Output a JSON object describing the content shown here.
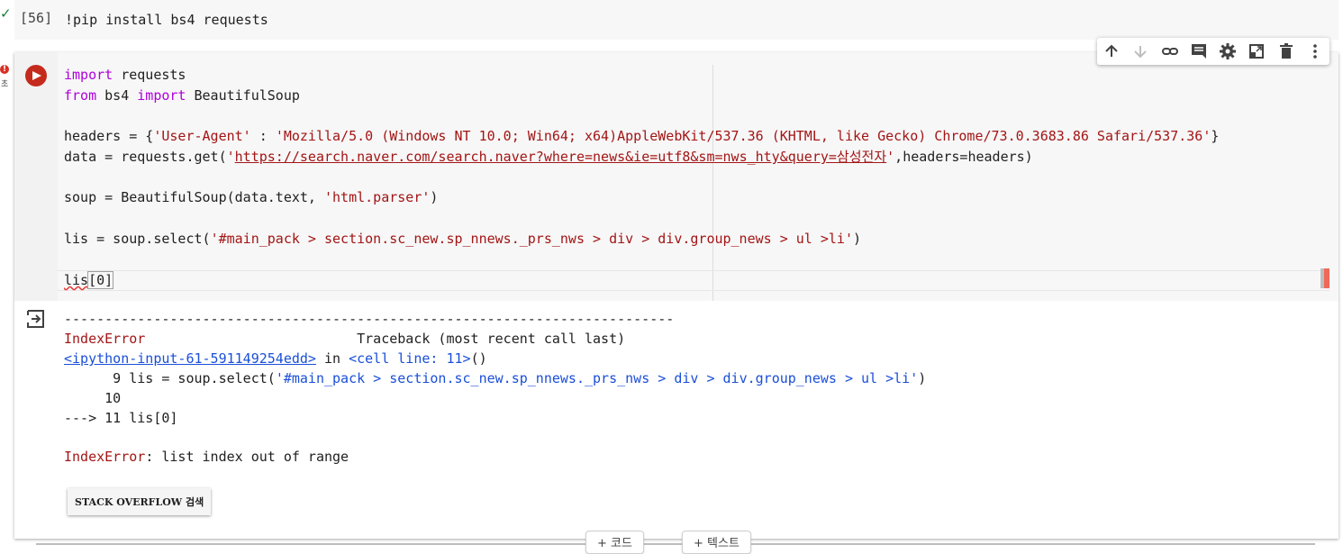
{
  "previous_cell": {
    "status": "✓",
    "exec_count": "[56]",
    "code": "!pip install bs4 requests"
  },
  "cell_error_marker": {
    "badge": "!",
    "sub": "초"
  },
  "toolbar": {
    "items": [
      "move-up",
      "move-down",
      "link",
      "comment",
      "settings",
      "mirror",
      "delete",
      "more"
    ]
  },
  "code": {
    "line1": {
      "kw": "import",
      "rest": " requests"
    },
    "line2": {
      "kw1": "from",
      "mid": " bs4 ",
      "kw2": "import",
      "rest": " BeautifulSoup"
    },
    "line3": {
      "pre": "headers = {",
      "key": "'User-Agent'",
      "colon": " : ",
      "val": "'Mozilla/5.0 (Windows NT 10.0; Win64; x64)AppleWebKit/537.36 (KHTML, like Gecko) Chrome/73.0.3683.86 Safari/537.36'",
      "post": "}"
    },
    "line4": {
      "pre": "data = requests.get(",
      "q1": "'",
      "url": "https://search.naver.com/search.naver?where=news&ie=utf8&sm=nws_hty&query=삼성전자",
      "q2": "'",
      "post": ",headers=headers)"
    },
    "line5": {
      "pre": "soup = BeautifulSoup(data.text, ",
      "str": "'html.parser'",
      "post": ")"
    },
    "line6": {
      "pre": "lis = soup.select(",
      "str": "'#main_pack > section.sc_new.sp_nnews._prs_nws > div > div.group_news > ul >li'",
      "post": ")"
    },
    "line7": {
      "pre": "lis",
      "bracket": "[0]"
    }
  },
  "output": {
    "dashes": "---------------------------------------------------------------------------",
    "err_name": "IndexError",
    "traceback_label": "                          Traceback (most recent call last)",
    "input_link": "<ipython-input-61-591149254edd>",
    "in_word": " in ",
    "cell_line": "<cell line: 11>",
    "cell_paren": "()",
    "tb_line9_num": "      9 ",
    "tb_line9_pre": "lis = soup.select(",
    "tb_line9_str": "'#main_pack > section.sc_new.sp_nnews._prs_nws > div > div.group_news > ul >li'",
    "tb_line9_post": ")",
    "tb_line10": "     10",
    "tb_line11_arrow": "---> 11 ",
    "tb_line11_code": "lis[0]",
    "final_err_name": "IndexError",
    "final_err_msg": ": list index out of range",
    "so_button": "STACK OVERFLOW 검색"
  },
  "add_buttons": {
    "code": "+ 코드",
    "text": "+ 텍스트"
  }
}
